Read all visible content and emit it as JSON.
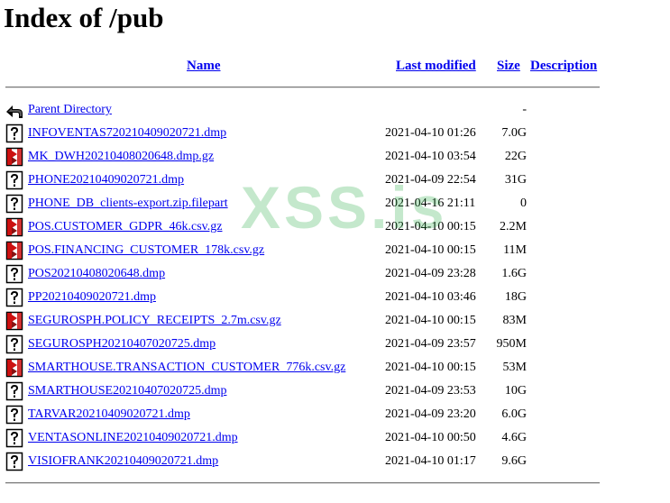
{
  "title": "Index of /pub",
  "columns": {
    "name": "Name",
    "last_modified": "Last modified",
    "size": "Size",
    "description": "Description"
  },
  "parent": {
    "label": "Parent Directory",
    "size": "-",
    "icon": "back-arrow-icon"
  },
  "files": [
    {
      "name": "INFOVENTAS720210409020721.dmp",
      "date": "2021-04-10 01:26",
      "size": "7.0G",
      "icon": "unknown-file-icon"
    },
    {
      "name": "MK_DWH20210408020648.dmp.gz",
      "date": "2021-04-10 03:54",
      "size": "22G",
      "icon": "compressed-file-icon"
    },
    {
      "name": "PHONE20210409020721.dmp",
      "date": "2021-04-09 22:54",
      "size": "31G",
      "icon": "unknown-file-icon"
    },
    {
      "name": "PHONE_DB_clients-export.zip.filepart",
      "date": "2021-04-16 21:11",
      "size": "0",
      "icon": "unknown-file-icon"
    },
    {
      "name": "POS.CUSTOMER_GDPR_46k.csv.gz",
      "date": "2021-04-10 00:15",
      "size": "2.2M",
      "icon": "compressed-file-icon"
    },
    {
      "name": "POS.FINANCING_CUSTOMER_178k.csv.gz",
      "date": "2021-04-10 00:15",
      "size": "11M",
      "icon": "compressed-file-icon"
    },
    {
      "name": "POS20210408020648.dmp",
      "date": "2021-04-09 23:28",
      "size": "1.6G",
      "icon": "unknown-file-icon"
    },
    {
      "name": "PP20210409020721.dmp",
      "date": "2021-04-10 03:46",
      "size": "18G",
      "icon": "unknown-file-icon"
    },
    {
      "name": "SEGUROSPH.POLICY_RECEIPTS_2.7m.csv.gz",
      "date": "2021-04-10 00:15",
      "size": "83M",
      "icon": "compressed-file-icon"
    },
    {
      "name": "SEGUROSPH20210407020725.dmp",
      "date": "2021-04-09 23:57",
      "size": "950M",
      "icon": "unknown-file-icon"
    },
    {
      "name": "SMARTHOUSE.TRANSACTION_CUSTOMER_776k.csv.gz",
      "date": "2021-04-10 00:15",
      "size": "53M",
      "icon": "compressed-file-icon"
    },
    {
      "name": "SMARTHOUSE20210407020725.dmp",
      "date": "2021-04-09 23:53",
      "size": "10G",
      "icon": "unknown-file-icon"
    },
    {
      "name": "TARVAR20210409020721.dmp",
      "date": "2021-04-09 23:20",
      "size": "6.0G",
      "icon": "unknown-file-icon"
    },
    {
      "name": "VENTASONLINE20210409020721.dmp",
      "date": "2021-04-10 00:50",
      "size": "4.6G",
      "icon": "unknown-file-icon"
    },
    {
      "name": "VISIOFRANK20210409020721.dmp",
      "date": "2021-04-10 01:17",
      "size": "9.6G",
      "icon": "unknown-file-icon"
    }
  ],
  "watermark": "XSS.is"
}
